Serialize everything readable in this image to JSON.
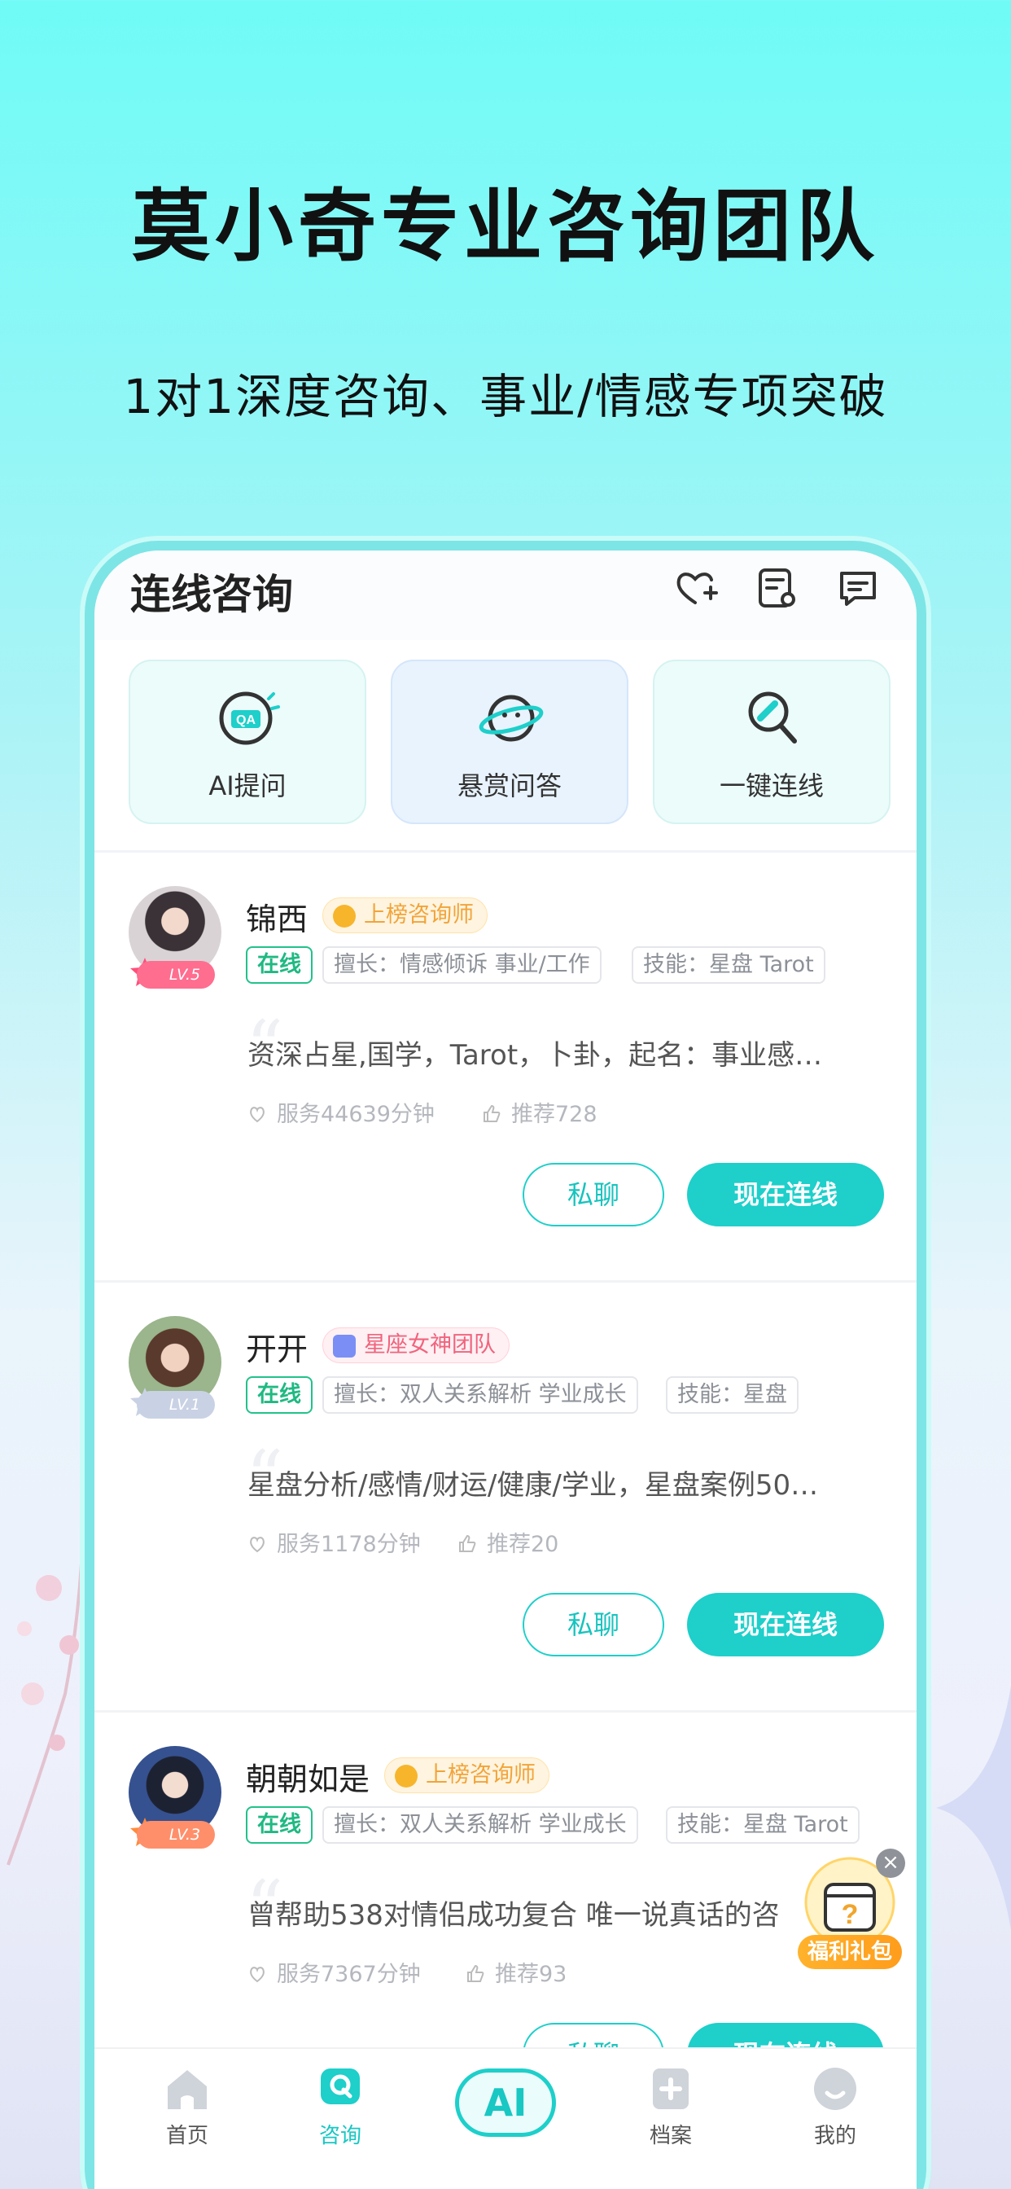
{
  "hero": {
    "headline": "莫小奇专业咨询团队",
    "subline": "1对1深度咨询、事业/情感专项突破"
  },
  "app": {
    "title": "连线咨询",
    "header_icons": [
      "heart-plus-icon",
      "order-list-icon",
      "message-icon"
    ],
    "features": [
      {
        "label": "AI提问",
        "icon": "qa-icon"
      },
      {
        "label": "悬赏问答",
        "icon": "planet-icon"
      },
      {
        "label": "一键连线",
        "icon": "connect-icon"
      }
    ],
    "consultants": [
      {
        "name": "锦西",
        "level": "LV.5",
        "badge": "上榜咨询师",
        "badge_style": "gold",
        "status": "在线",
        "specialty": "擅长：情感倾诉 事业/工作",
        "skills": "技能：星盘 Tarot",
        "intro": "资深占星,国学，Tarot，卜卦，起名：事业感…",
        "service": "服务44639分钟",
        "recommend": "推荐728",
        "chat_label": "私聊",
        "call_label": "现在连线"
      },
      {
        "name": "开开",
        "level": "LV.1",
        "badge": "星座女神团队",
        "badge_style": "pink",
        "status": "在线",
        "specialty": "擅长：双人关系解析 学业成长",
        "skills": "技能：星盘",
        "intro": "星盘分析/感情/财运/健康/学业，星盘案例50…",
        "service": "服务1178分钟",
        "recommend": "推荐20",
        "chat_label": "私聊",
        "call_label": "现在连线"
      },
      {
        "name": "朝朝如是",
        "level": "LV.3",
        "badge": "上榜咨询师",
        "badge_style": "gold",
        "status": "在线",
        "specialty": "擅长：双人关系解析 学业成长",
        "skills": "技能：星盘 Tarot",
        "intro": "曾帮助538对情侣成功复合  唯一说真话的咨",
        "service": "服务7367分钟",
        "recommend": "推荐93",
        "chat_label": "私聊",
        "call_label": "现在连线"
      }
    ],
    "gift_label": "福利礼包",
    "tabs": [
      {
        "label": "首页",
        "icon": "home-icon"
      },
      {
        "label": "咨询",
        "icon": "consult-icon"
      },
      {
        "label": "AI",
        "icon": "ai-icon"
      },
      {
        "label": "档案",
        "icon": "archive-icon"
      },
      {
        "label": "我的",
        "icon": "profile-icon"
      }
    ],
    "active_tab": "咨询"
  },
  "colors": {
    "accent": "#1ecfca",
    "online": "#1fb982",
    "gold_badge": "#f1a43a",
    "pink_badge": "#f0647e"
  }
}
